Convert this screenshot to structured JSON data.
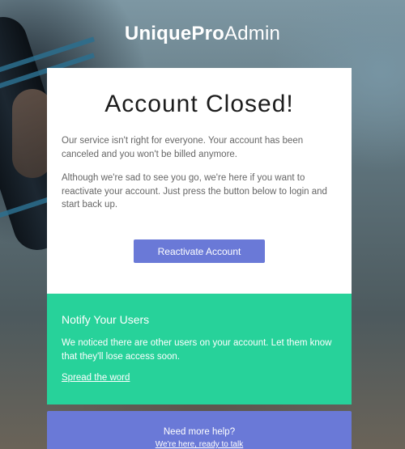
{
  "brand": {
    "name_bold": "UniquePro",
    "name_light": "Admin"
  },
  "closed_card": {
    "title": "Account Closed!",
    "paragraph_1": "Our service isn't right for everyone. Your account has been canceled and you won't be billed anymore.",
    "paragraph_2": "Although we're sad to see you go, we're here if you want to reactivate your account. Just press the button below to login and start back up.",
    "reactivate_button_label": "Reactivate Account"
  },
  "notify_card": {
    "title": "Notify Your Users",
    "text": "We noticed there are other users on your account. Let them know that they'll lose access soon.",
    "link_label": "Spread the word"
  },
  "help_card": {
    "title": "Need more help?",
    "link_label": "We're here, ready to talk"
  },
  "colors": {
    "accent_purple": "#6a79d7",
    "accent_green": "#27d29a",
    "card_background": "#ffffff"
  }
}
